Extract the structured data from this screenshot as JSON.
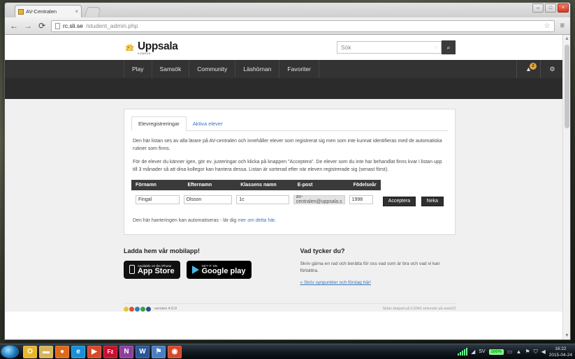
{
  "browser": {
    "tab_title": "AV-Centralen",
    "tab_close": "×",
    "url_host": "rc.sli.se",
    "url_path": "/student_admin.php",
    "back_icon": "←",
    "forward_icon": "→",
    "reload_icon": "⟳",
    "star_icon": "☆",
    "menu_icon": "≡",
    "minimize": "–",
    "maximize": "□",
    "close": "×"
  },
  "site": {
    "logo_text": "Uppsala",
    "logo_sub": "KOMMUN"
  },
  "search": {
    "placeholder": "Sök",
    "clear_icon": "○",
    "button_icon": "⌕"
  },
  "nav": {
    "items": [
      {
        "label": "Play"
      },
      {
        "label": "Samsök"
      },
      {
        "label": "Community"
      },
      {
        "label": "Läshörnan"
      },
      {
        "label": "Favoriter"
      }
    ],
    "bell_icon": "▲",
    "badge_count": "2",
    "gear_icon": "⚙"
  },
  "card": {
    "tabs": [
      {
        "label": "Elevregistreringar",
        "active": true
      },
      {
        "label": "Aktiva elever",
        "active": false
      }
    ],
    "paragraph1": "Den här listan ses av alla lärare på AV-centralen och innehåller elever som registrerat sig men som inte kunnat identifieras med de automatiska rutiner som finns.",
    "paragraph2": "För de elever du känner igen, gör ev. justeringar och klicka på knappen \"Acceptera\". De elever som du inte har behandlat finns kvar i listan upp till 3 månader så att dina kollegor kan hantera dessa. Listan är sorterad efter när eleven registrerade sig (senast först).",
    "table": {
      "headers": [
        "Förnamn",
        "Efternamn",
        "Klassens namn",
        "E-post",
        "Födelseår"
      ],
      "rows": [
        {
          "fornamn": "Fingal",
          "efternamn": "Olsson",
          "klass": "1c",
          "epost": "av-centralen@uppsala.s",
          "fodelsear": "1998",
          "accept_label": "Acceptera",
          "reject_label": "Neka"
        }
      ]
    },
    "note_text": "Den här hanteringen kan automatiseras - lär dig ",
    "note_link": "mer om detta här",
    "note_end": "."
  },
  "mobile": {
    "heading": "Ladda hem vår mobilapp!",
    "apple_small": "Available on the iPhone",
    "apple_large": "App Store",
    "google_small": "GET IT ON",
    "google_large": "Google play"
  },
  "feedback": {
    "heading": "Vad tycker du?",
    "text": "Skriv gärna en rad och berätta för oss vad som är bra och vad vi kan förbättra.",
    "link": "» Skriv synpunkter och förslag här!"
  },
  "footer": {
    "version": "version 4.0.0",
    "right_text": "Sidan skapad på 0,0343 sekunder på www23",
    "dot_colors": [
      "#e8c33a",
      "#d8542e",
      "#2f7fc1",
      "#3aa04a",
      "#2b4f8e"
    ]
  },
  "taskbar": {
    "items": [
      {
        "name": "outlook",
        "glyph": "O",
        "color": "#e8b62c"
      },
      {
        "name": "explorer-folder",
        "glyph": "▬",
        "color": "#d8b45c"
      },
      {
        "name": "firefox",
        "glyph": "●",
        "color": "#e06a1b"
      },
      {
        "name": "internet-explorer",
        "glyph": "e",
        "color": "#1b8fd6"
      },
      {
        "name": "media-player",
        "glyph": "▶",
        "color": "#d64a2a"
      },
      {
        "name": "filezilla",
        "glyph": "Fz",
        "color": "#c8102e"
      },
      {
        "name": "onenote",
        "glyph": "N",
        "color": "#8e3f9e"
      },
      {
        "name": "word",
        "glyph": "W",
        "color": "#2a5699"
      },
      {
        "name": "pin-tool",
        "glyph": "⚑",
        "color": "#4a7fc1"
      },
      {
        "name": "chrome",
        "glyph": "◉",
        "color": "#d64a2a"
      }
    ],
    "tray": {
      "language": "SV",
      "battery": "100%",
      "time": "16:22",
      "date": "2015-04-24",
      "show_desktop_icon": "▭",
      "arrow_icon": "▲",
      "flag_icon": "⚑",
      "shield_icon": "⛉",
      "volume_icon": "◀",
      "network_icon": "◢"
    }
  }
}
